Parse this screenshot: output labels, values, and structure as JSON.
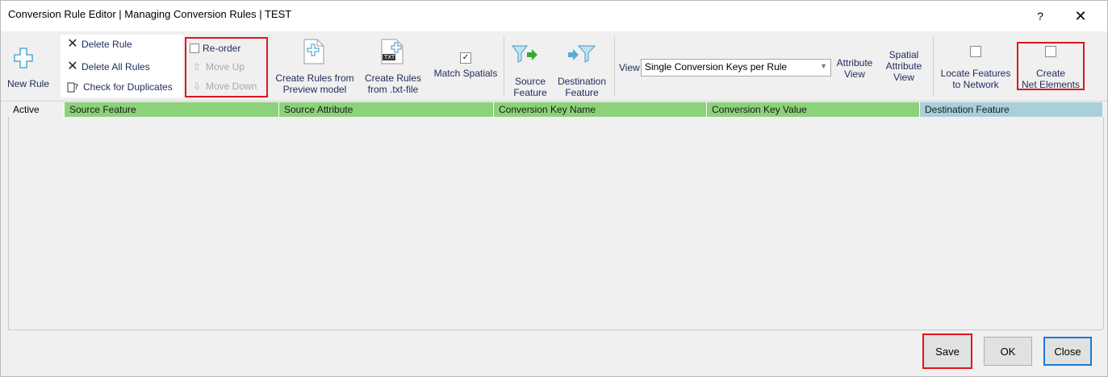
{
  "window": {
    "title": "Conversion Rule Editor | Managing Conversion Rules | TEST",
    "help_glyph": "?",
    "close_glyph": "✕"
  },
  "toolbar": {
    "new_rule": "New Rule",
    "delete_rule": "Delete Rule",
    "delete_all_rules": "Delete All Rules",
    "check_duplicates": "Check for Duplicates",
    "reorder": "Re-order",
    "move_up": "Move Up",
    "move_down": "Move Down",
    "create_from_preview_l1": "Create Rules from",
    "create_from_preview_l2": "Preview model",
    "create_from_txt_l1": "Create Rules",
    "create_from_txt_l2": "from .txt-file",
    "txt_badge": "TXT",
    "match_spatials": "Match Spatials",
    "match_spatials_checked": true,
    "source_feature_l1": "Source",
    "source_feature_l2": "Feature",
    "destination_feature_l1": "Destination",
    "destination_feature_l2": "Feature",
    "view_label": "View",
    "view_selected": "Single Conversion Keys per Rule",
    "attribute_view_l1": "Attribute",
    "attribute_view_l2": "View",
    "spatial_view_l1": "Spatial",
    "spatial_view_l2": "Attribute",
    "spatial_view_l3": "View",
    "locate_l1": "Locate Features",
    "locate_l2": "to Network",
    "create_net_l1": "Create",
    "create_net_l2": "Net Elements"
  },
  "grid": {
    "columns": [
      "Active",
      "Source Feature",
      "Source Attribute",
      "Conversion Key Name",
      "Conversion Key Value",
      "Destination Feature"
    ],
    "rows": []
  },
  "buttons": {
    "save": "Save",
    "ok": "OK",
    "close": "Close"
  },
  "colors": {
    "highlight_red": "#e0141e",
    "focus_blue": "#1a7ad9",
    "header_green": "#8cd27a",
    "header_blue": "#a9cfd8",
    "icon_blue": "#5aa9d6"
  }
}
